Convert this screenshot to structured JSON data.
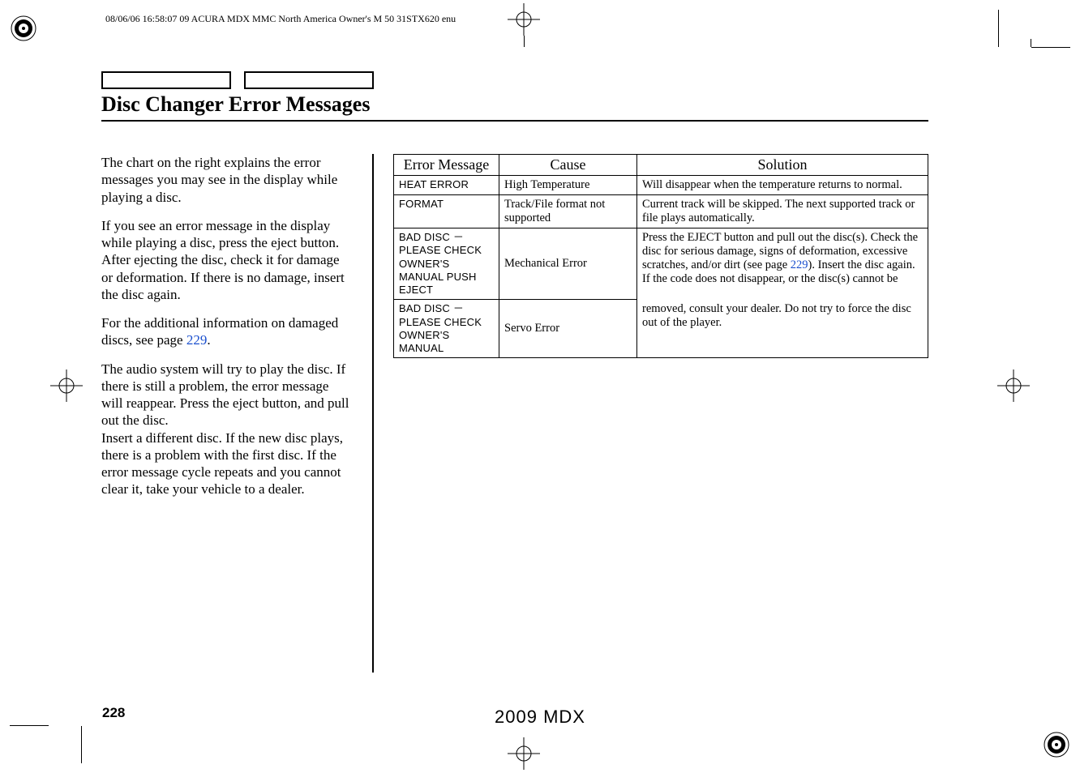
{
  "meta": {
    "header": "08/06/06 16:58:07    09 ACURA MDX MMC North America Owner's M 50 31STX620 enu"
  },
  "title": "Disc Changer Error Messages",
  "body": {
    "p1": "The chart on the right explains the error messages you may see in the display while playing a disc.",
    "p2": "If you see an error message in the display while playing a disc, press the eject button. After ejecting the disc, check it for damage or deformation. If there is no damage, insert the disc again.",
    "p3a": "For the additional information on damaged discs, see page ",
    "p3link": "229",
    "p3b": ".",
    "p4": "The audio system will try to play the disc. If there is still a problem, the error message will reappear. Press the eject button, and pull out the disc.",
    "p5": "Insert a different disc. If the new disc plays, there is a problem with the first disc. If the error message cycle repeats and you cannot clear it, take your vehicle to a dealer."
  },
  "table": {
    "head": {
      "c1": "Error Message",
      "c2": "Cause",
      "c3": "Solution"
    },
    "r1": {
      "msg": "HEAT ERROR",
      "cause": "High Temperature",
      "sol": "Will disappear when the temperature returns to normal."
    },
    "r2": {
      "msg": "FORMAT",
      "cause": "Track/File format not supported",
      "sol": "Current track will be skipped. The next supported track or file plays automatically."
    },
    "r3": {
      "msg": "BAD DISC －\nPLEASE CHECK\nOWNER'S\nMANUAL PUSH\nEJECT",
      "cause": "Mechanical Error",
      "sol_a": "Press the EJECT button and pull out the disc(s). Check the disc for serious damage, signs of deformation, excessive scratches, and/or dirt (see page ",
      "sol_link": "229",
      "sol_b": "). Insert the disc again. If the code does not disappear, or the disc(s) cannot be"
    },
    "r4": {
      "msg": "BAD DISC －\nPLEASE CHECK\nOWNER'S\nMANUAL",
      "cause": "Servo Error",
      "sol": "removed, consult your dealer. Do not try to force the disc out of the player."
    }
  },
  "footer": {
    "page": "228",
    "model": "2009  MDX"
  }
}
